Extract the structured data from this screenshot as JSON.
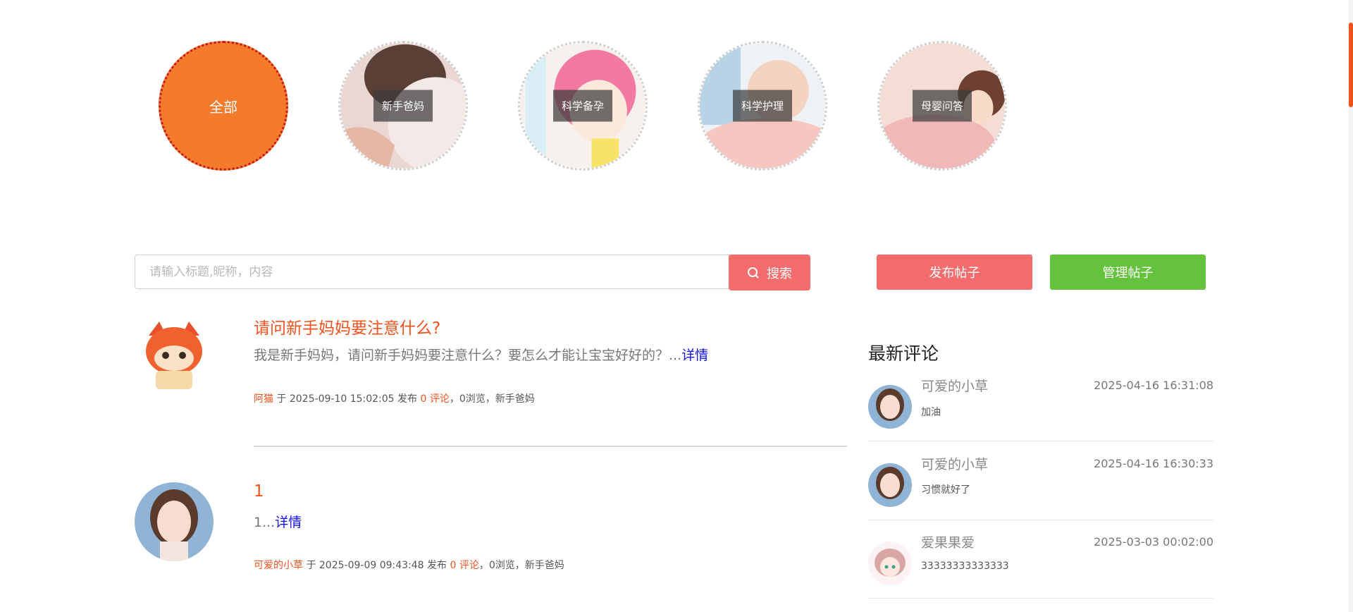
{
  "categories": [
    {
      "label": "全部",
      "active": true
    },
    {
      "label": "新手爸妈",
      "active": false
    },
    {
      "label": "科学备孕",
      "active": false
    },
    {
      "label": "科学护理",
      "active": false
    },
    {
      "label": "母婴问答",
      "active": false
    }
  ],
  "search": {
    "placeholder": "请输入标题,昵称，内容",
    "button_label": "搜索"
  },
  "actions": {
    "publish_label": "发布帖子",
    "manage_label": "管理帖子"
  },
  "posts": [
    {
      "title": "请问新手妈妈要注意什么?",
      "summary": "我是新手妈妈，请问新手妈妈要注意什么？要怎么才能让宝宝好好的？...",
      "detail_label": "详情",
      "author": "阿猫",
      "at": " 于 2025-09-10 15:02:05 发布 ",
      "comments": "0 评论",
      "rest": "，0浏览，新手爸妈"
    },
    {
      "title": "1",
      "summary": "1...",
      "detail_label": "详情",
      "author": "可爱的小草",
      "at": " 于 2025-09-09 09:43:48 发布 ",
      "comments": "0 评论",
      "rest": "，0浏览，新手爸妈"
    }
  ],
  "latest_comments": {
    "title": "最新评论",
    "items": [
      {
        "name": "可爱的小草",
        "time": "2025-04-16 16:31:08",
        "text": "加油"
      },
      {
        "name": "可爱的小草",
        "time": "2025-04-16 16:30:33",
        "text": "习惯就好了"
      },
      {
        "name": "爱果果爱",
        "time": "2025-03-03 00:02:00",
        "text": "33333333333333"
      }
    ]
  },
  "colors": {
    "accent_orange": "#f57b2c",
    "link_red": "#f2521c",
    "button_red": "#f46c6c",
    "button_green": "#64c23c",
    "detail_blue": "#1111ee"
  }
}
